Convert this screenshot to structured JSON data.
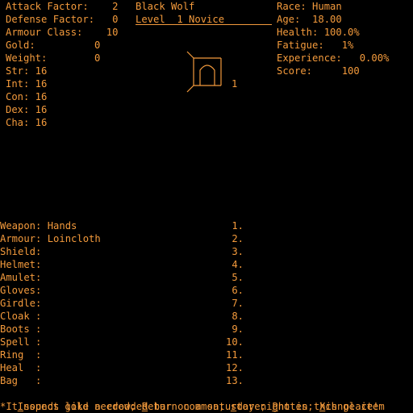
{
  "stats": {
    "attack_factor": "Attack Factor:    2",
    "defense_factor": "Defense Factor:   0",
    "armour_class": "Armour Class:    10",
    "gold": "Gold:          0",
    "weight": "Weight:        0",
    "str": "Str: 16",
    "int": "Int: 16",
    "con": "Con: 16",
    "dex": "Dex: 16",
    "cha": "Cha: 16"
  },
  "character": {
    "name": "Black Wolf",
    "level": "Level  1 Novice"
  },
  "status": {
    "race": "Race: Human",
    "age": "Age:  18.00",
    "health": "Health: 100.0%",
    "fatigue": "Fatigue:   1%",
    "experience": "Experience:   0.00%",
    "score": "Score:     100"
  },
  "view": {
    "icon": "doorway-icon",
    "number": "1"
  },
  "equipment": [
    "Weapon: Hands",
    "Armour: Loincloth",
    "Shield:",
    "Helmet:",
    "Amulet:",
    "Gloves:",
    "Girdle:",
    "Cloak :",
    "Boots :",
    "Spell :",
    "Ring  :",
    "Heal  :",
    "Bag   :"
  ],
  "slot_numbers": [
    "1.",
    "2.",
    "3.",
    "4.",
    "5.",
    "6.",
    "7.",
    "8.",
    "9.",
    "10.",
    "11.",
    "12.",
    "13."
  ],
  "commands": {
    "inspect_key": "I",
    "inspect_rest": "nspect gold needed; ",
    "return_key": "R",
    "return_rest": "eturn common; ",
    "store_key": "s",
    "store_rest": "tore; ",
    "pnotes_key": "P",
    "pnotes_rest": "notes; ",
    "xchnge_key": "X",
    "xchnge_rest": "chnge item"
  },
  "message": "*It sounds like a crowded bar on a saturday night in this place!",
  "colors": {
    "text": "#f39a3c",
    "background": "#000000"
  }
}
